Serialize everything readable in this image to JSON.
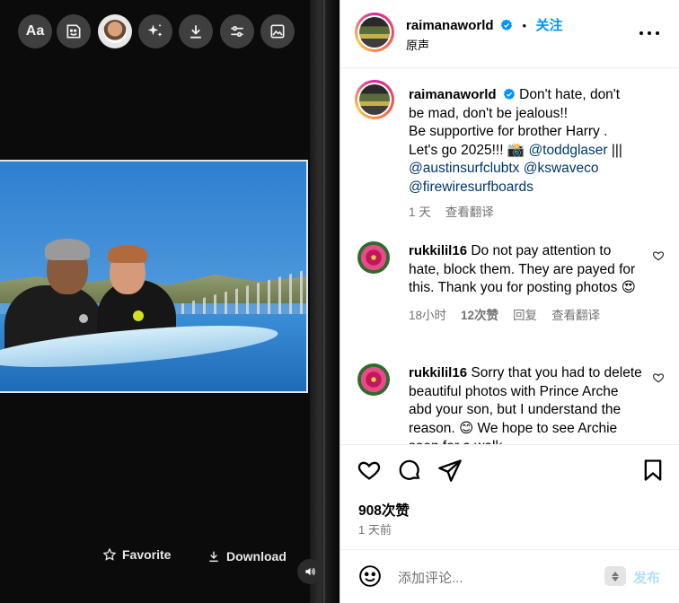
{
  "media": {
    "tools": [
      {
        "name": "text-tool",
        "label": "Aa"
      },
      {
        "name": "sticker-tool"
      },
      {
        "name": "avatar-tool"
      },
      {
        "name": "effects-tool"
      },
      {
        "name": "download-tool"
      },
      {
        "name": "adjust-tool"
      },
      {
        "name": "gallery-tool"
      }
    ],
    "favorite_label": "Favorite",
    "download_label": "Download"
  },
  "post": {
    "author": "raimanaworld",
    "follow_label": "关注",
    "audio_label": "原声",
    "caption": {
      "username": "raimanaworld",
      "lines": [
        "Don't hate, don't",
        "be mad, don't be jealous!!",
        "Be supportive for brother Harry .",
        "Let's go 2025!!! 📸"
      ],
      "mentions": [
        "@toddglaser",
        "@austinsurfclubtx",
        "@kswaveco",
        "@firewiresurfboards"
      ],
      "separator": "|||",
      "time": "1 天",
      "translate": "查看翻译"
    },
    "comments": [
      {
        "username": "rukkilil16",
        "text": "Do not pay attention to hate, block them. They are payed for this. Thank you for posting photos 😍",
        "time": "18小时",
        "likes": "12次赞",
        "reply": "回复",
        "translate": "查看翻译"
      },
      {
        "username": "rukkilil16",
        "text": "Sorry that you had to delete beautiful photos with Prince Arche abd your son, but I understand the reason. 😊 We hope to see Archie soon for a walk",
        "time": "",
        "likes": "",
        "reply": "",
        "translate": ""
      }
    ],
    "likes_count": "908次赞",
    "date": "1 天前",
    "comment_placeholder": "添加评论...",
    "post_label": "发布"
  },
  "colors": {
    "link": "#0095f6",
    "mention": "#00376b",
    "muted": "#737373",
    "post_disabled": "#b2dffc"
  }
}
